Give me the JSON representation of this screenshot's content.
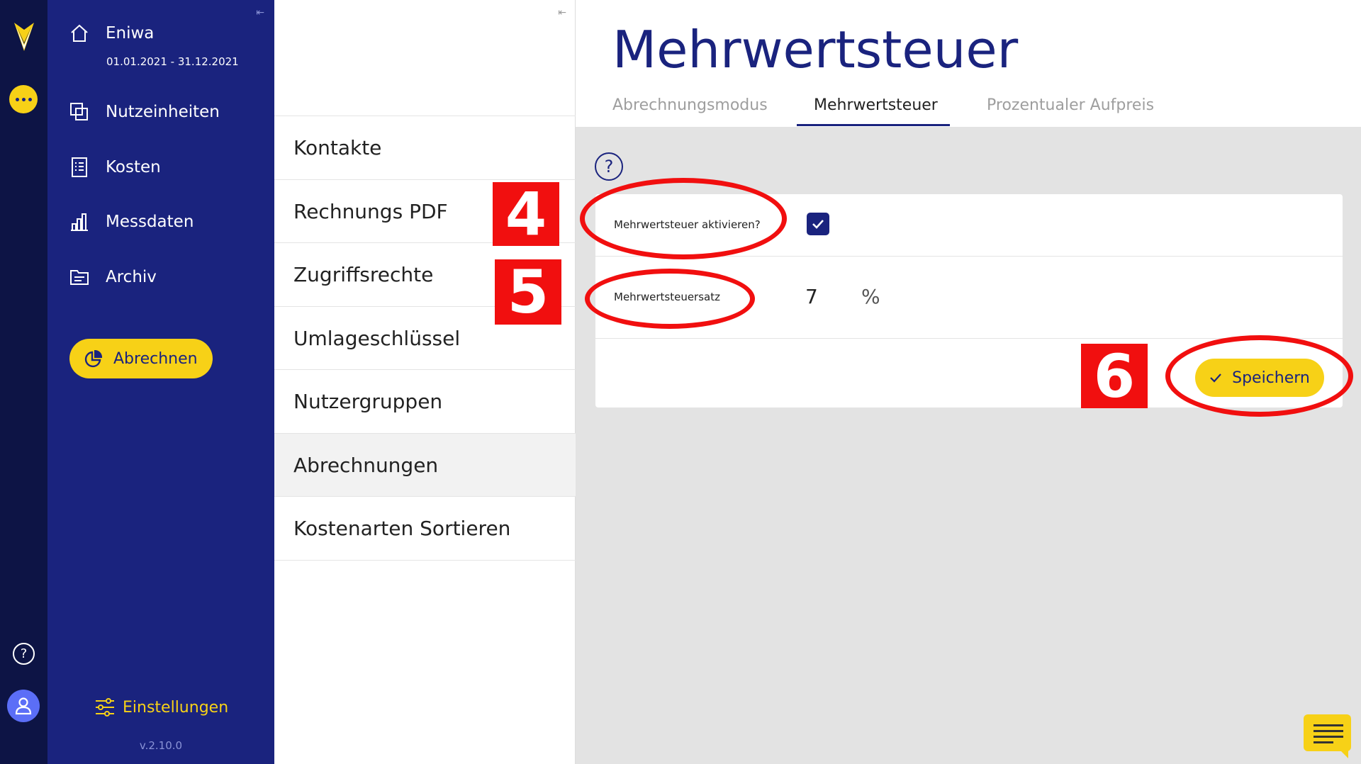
{
  "sidebar": {
    "company": "Eniwa",
    "period": "01.01.2021 - 31.12.2021",
    "items": [
      {
        "label": "Nutzeinheiten",
        "icon": "units-icon"
      },
      {
        "label": "Kosten",
        "icon": "receipt-icon"
      },
      {
        "label": "Messdaten",
        "icon": "bar-chart-icon"
      },
      {
        "label": "Archiv",
        "icon": "folder-icon"
      }
    ],
    "abrechnen_label": "Abrechnen",
    "settings_label": "Einstellungen",
    "version": "v.2.10.0"
  },
  "settings_list": {
    "items": [
      "Kontakte",
      "Rechnungs PDF",
      "Zugriffsrechte",
      "Umlageschlüssel",
      "Nutzergruppen",
      "Abrechnungen",
      "Kostenarten Sortieren"
    ],
    "active_index": 5
  },
  "main": {
    "title": "Mehrwertsteuer",
    "tabs": [
      "Abrechnungsmodus",
      "Mehrwertsteuer",
      "Prozentualer Aufpreis"
    ],
    "active_tab": 1,
    "activate_label": "Mehrwertsteuer aktivieren?",
    "activate_checked": true,
    "rate_label": "Mehrwertsteuersatz",
    "rate_value": "7",
    "rate_unit": "%",
    "save_label": "Speichern"
  },
  "annotations": {
    "step_a": "4",
    "step_b": "5",
    "step_c": "6"
  },
  "colors": {
    "navy": "#1a237e",
    "yellow": "#f7d117",
    "annotation_red": "#f10f0f"
  }
}
